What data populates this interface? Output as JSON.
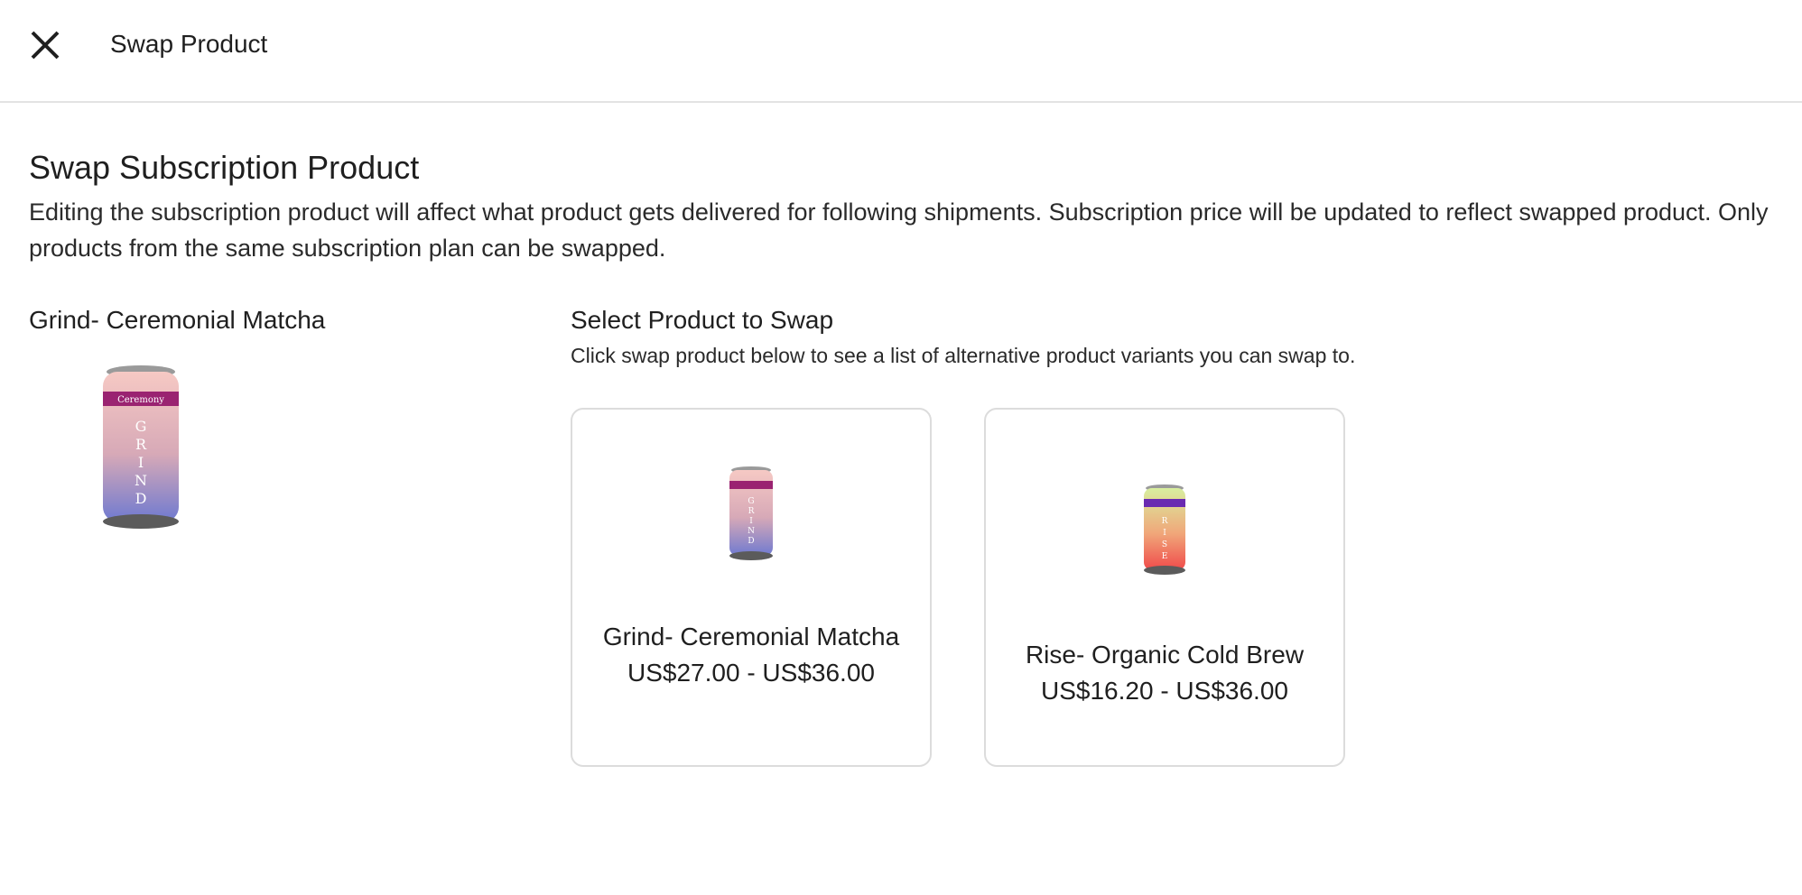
{
  "header": {
    "close_icon": "close-icon",
    "title": "Swap Product"
  },
  "main": {
    "heading": "Swap Subscription Product",
    "description": "Editing the subscription product will affect what product gets delivered for following shipments. Subscription price will be updated to reflect swapped product. Only products from the same subscription plan can be swapped."
  },
  "current_product": {
    "name": "Grind- Ceremonial Matcha",
    "image_alt": "Grind- Ceremonial Matcha can",
    "can_label_top": "Ceremony",
    "can_word": "GRIND",
    "colors": {
      "top": "#f6c9c4",
      "bottom": "#6f7ad0",
      "band": "#b12b6f"
    }
  },
  "swap_section": {
    "title": "Select Product to Swap",
    "description": "Click swap product below to see a list of alternative product variants you can swap to.",
    "options": [
      {
        "name": "Grind- Ceremonial Matcha",
        "price": "US$27.00 - US$36.00",
        "image_alt": "Grind- Ceremonial Matcha can",
        "colors": {
          "top": "#f6c9c4",
          "bottom": "#6f7ad0",
          "band": "#b12b6f"
        }
      },
      {
        "name": "Rise- Organic Cold Brew",
        "price": "US$16.20 - US$36.00",
        "image_alt": "Rise- Organic Cold Brew can",
        "colors": {
          "top": "#d8ef9f",
          "bottom": "#f04a4a",
          "band": "#6a2bb1"
        }
      }
    ]
  }
}
